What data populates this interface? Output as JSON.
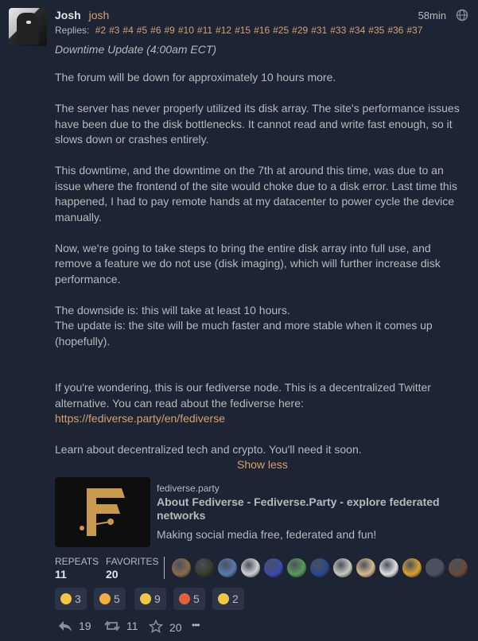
{
  "post": {
    "author_name": "Josh",
    "author_handle": "josh",
    "time": "58min",
    "replies_label": "Replies:",
    "replies": [
      "#2",
      "#3",
      "#4",
      "#5",
      "#6",
      "#9",
      "#10",
      "#11",
      "#12",
      "#15",
      "#16",
      "#25",
      "#29",
      "#31",
      "#33",
      "#34",
      "#35",
      "#36",
      "#37"
    ],
    "subject": "Downtime Update (4:00am ECT)",
    "paragraphs": [
      "The forum will be down for approximately 10 hours more.",
      "The server has never properly utilized its disk array. The site's performance issues have been due to the disk bottlenecks. It cannot read and write fast enough, so it slows down or crashes entirely.",
      "This downtime, and the downtime on the 7th at around this time, was due to an issue where the frontend of the site would choke due to a disk error. Last time this happened, I had to pay remote hands at my datacenter to power cycle the device manually.",
      "Now, we're going to take steps to bring the entire disk array into full use, and remove a feature we do not use (disk imaging), which will further increase disk performance.",
      "The downside is: this will take at least 10 hours.",
      "The update is: the site will be much faster and more stable when it comes up (hopefully).",
      "If you're wondering, this is our fediverse node. This is a decentralized Twitter alternative. You can read about the fediverse here:",
      "https://fediverse.party/en/fediverse",
      "Learn about decentralized tech and crypto. You'll need it soon."
    ],
    "show_less": "Show less"
  },
  "card": {
    "site": "fediverse.party",
    "title": "About Fediverse - Fediverse.Party - explore federated networks",
    "description": "Making social media free, federated and fun!",
    "logo_color": "#c99a4e"
  },
  "stats": {
    "repeats_label": "REPEATS",
    "repeats_count": "11",
    "favorites_label": "FAVORITES",
    "favorites_count": "20",
    "favoriter_avatar_colors": [
      "#8a6a4a",
      "#3a3a2a",
      "#5a7ab0",
      "#d0d0d0",
      "#3a4ab0",
      "#5a9a5a",
      "#2a4a8a",
      "#c8c8c0",
      "#d8b890",
      "#e0e0e0",
      "#d8a030",
      "#4a5060",
      "#6a4a3a"
    ]
  },
  "reactions": [
    {
      "icon": "grin-emoji-icon",
      "color": "#f4c542",
      "count": "3"
    },
    {
      "icon": "clap-emoji-icon",
      "color": "#f0b040",
      "count": "5"
    },
    {
      "icon": "thumbs-up-emoji-icon",
      "color": "#f4c542",
      "count": "9"
    },
    {
      "icon": "rainbow-emoji-icon",
      "color": "#e06040",
      "count": "5"
    },
    {
      "icon": "sad-emoji-icon",
      "color": "#f4c542",
      "count": "2"
    }
  ],
  "actions": {
    "reply_count": "19",
    "repeat_count": "11",
    "favorite_count": "20",
    "more_label": "•••"
  }
}
